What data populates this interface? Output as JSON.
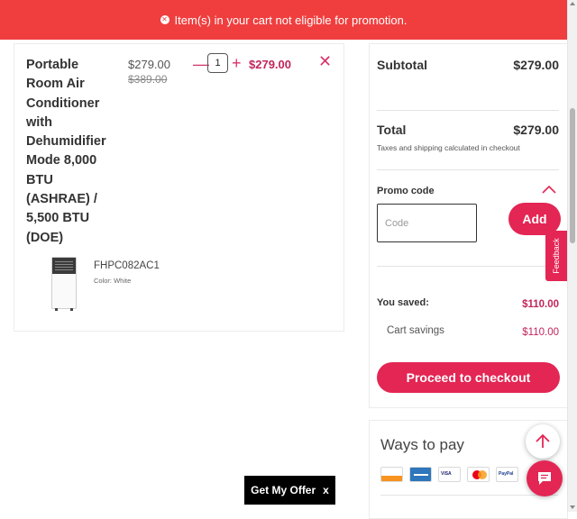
{
  "banner": {
    "message": "Item(s) in your cart not eligible for promotion."
  },
  "cart_item": {
    "title": "Portable Room Air Conditioner with Dehumidifier Mode 8,000 BTU (ASHRAE) / 5,500 BTU (DOE)",
    "price": "$279.00",
    "original_price": "$389.00",
    "quantity": "1",
    "line_total": "$279.00",
    "sku": "FHPC082AC1",
    "color": "Color: White"
  },
  "summary": {
    "subtotal_label": "Subtotal",
    "subtotal_value": "$279.00",
    "total_label": "Total",
    "total_value": "$279.00",
    "tax_note": "Taxes and shipping calculated in checkout",
    "promo_label": "Promo code",
    "promo_placeholder": "Code",
    "add_label": "Add",
    "saved_label": "You saved:",
    "saved_value": "$110.00",
    "savings_label": "Cart savings",
    "savings_value": "$110.00",
    "checkout_label": "Proceed to checkout"
  },
  "payment": {
    "title": "Ways to pay",
    "methods": [
      "DISCOVER",
      "AMEX",
      "VISA",
      "Mastercard",
      "PayPal"
    ]
  },
  "feedback_label": "Feedback",
  "offer": {
    "label": "Get My Offer",
    "close": "x"
  },
  "colors": {
    "accent": "#e32654",
    "banner": "#f03e3e",
    "price_accent": "#c2255c"
  }
}
